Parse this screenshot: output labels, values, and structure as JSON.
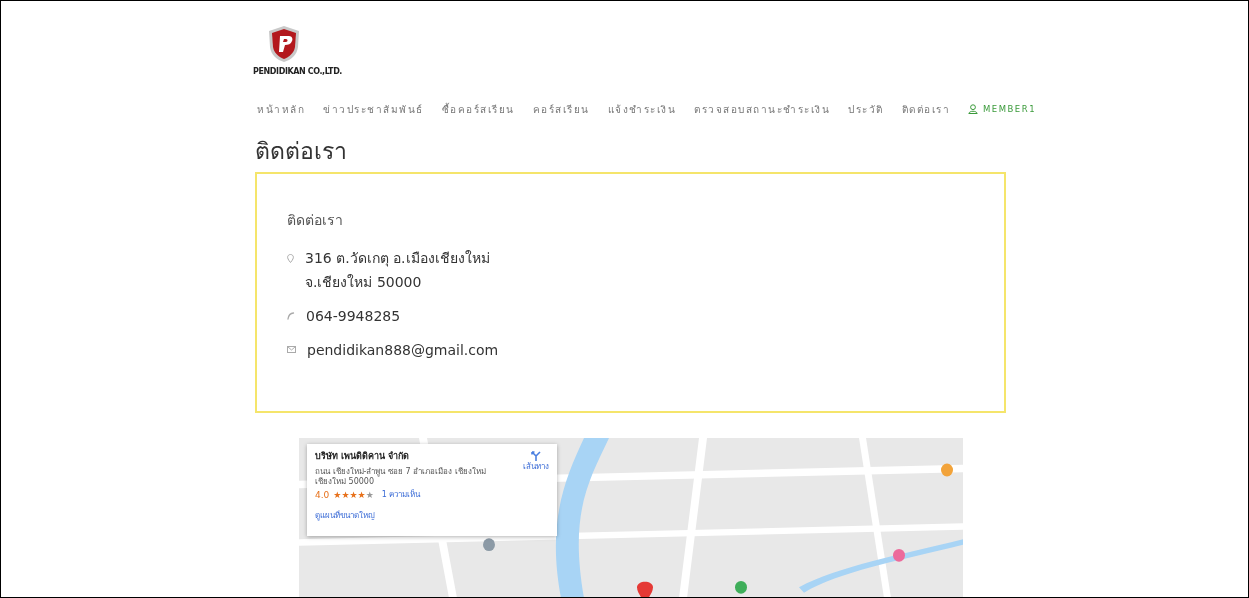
{
  "logo": {
    "company": "PENDIDIKAN CO.,LTD."
  },
  "nav": [
    {
      "label": "หน้าหลัก",
      "selected": false
    },
    {
      "label": "ข่าวประชาสัมพันธ์",
      "selected": false
    },
    {
      "label": "ซื้อคอร์สเรียน",
      "selected": false
    },
    {
      "label": "คอร์สเรียน",
      "selected": false
    },
    {
      "label": "แจ้งชำระเงิน",
      "selected": false
    },
    {
      "label": "ตรวจสอบสถานะชำระเงิน",
      "selected": false
    },
    {
      "label": "ประวัติ",
      "selected": false
    },
    {
      "label": "ติดต่อเรา",
      "selected": false
    }
  ],
  "member": {
    "label": "MEMBER1"
  },
  "page_title": "ติดต่อเรา",
  "contact": {
    "heading": "ติดต่อเรา",
    "items": [
      {
        "kind": "address",
        "lines": [
          "316 ต.วัดเกตุ อ.เมืองเชียงใหม่",
          "จ.เชียงใหม่ 50000"
        ]
      },
      {
        "kind": "phone",
        "lines": [
          "064-9948285"
        ]
      },
      {
        "kind": "email",
        "lines": [
          "pendidikan888@gmail.com"
        ]
      }
    ]
  },
  "map": {
    "kind": "picture",
    "place_card": {
      "name": "บริษัท เพนดิดิคาน จำกัด",
      "address": "ถนน เชียงใหม่-ลำพูน ซอย 7 อำเภอเมือง เชียงใหม่ เชียงใหม่ 50000",
      "rating": "4.0",
      "stars": 4,
      "reviews": "1 ความเห็น",
      "directions": "เส้นทาง",
      "larger_map": "ดูแผนที่ขนาดใหญ่"
    }
  }
}
